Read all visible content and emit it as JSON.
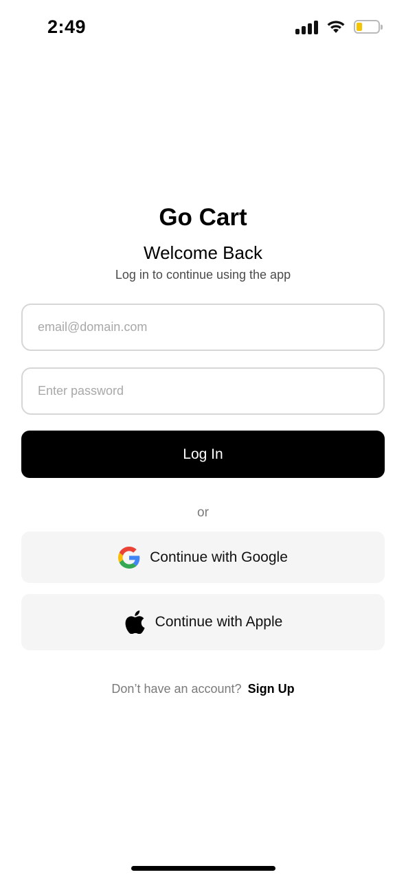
{
  "status_bar": {
    "time": "2:49",
    "icons": [
      "cellular-signal-icon",
      "wifi-icon",
      "battery-icon"
    ],
    "battery_level": 0.25,
    "battery_color": "#f5c400"
  },
  "header": {
    "app_title": "Go Cart",
    "welcome": "Welcome Back",
    "subtitle": "Log in to continue using the app"
  },
  "form": {
    "email_placeholder": "email@domain.com",
    "email_value": "",
    "password_placeholder": "Enter password",
    "password_value": "",
    "login_label": "Log In"
  },
  "divider": {
    "or_label": "or"
  },
  "social": {
    "google_label": "Continue with Google",
    "google_icon": "google-icon",
    "apple_label": "Continue with Apple",
    "apple_icon": "apple-icon"
  },
  "footer": {
    "prompt": "Don’t have an account?",
    "signup_label": "Sign Up"
  },
  "colors": {
    "primary_button": "#000000",
    "social_button_bg": "#f5f5f5",
    "muted_text": "#7a7a7a"
  }
}
